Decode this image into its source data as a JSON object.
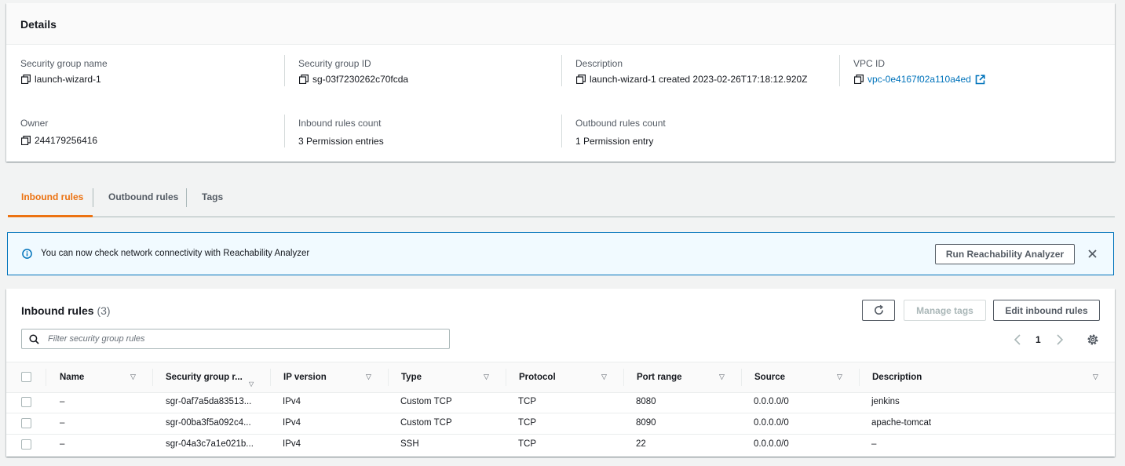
{
  "details": {
    "title": "Details",
    "fields": {
      "sg_name": {
        "label": "Security group name",
        "value": "launch-wizard-1"
      },
      "sg_id": {
        "label": "Security group ID",
        "value": "sg-03f7230262c70fcda"
      },
      "description": {
        "label": "Description",
        "value": "launch-wizard-1 created 2023-02-26T17:18:12.920Z"
      },
      "vpc_id": {
        "label": "VPC ID",
        "value": "vpc-0e4167f02a110a4ed"
      },
      "owner": {
        "label": "Owner",
        "value": "244179256416"
      },
      "inbound_count": {
        "label": "Inbound rules count",
        "value": "3 Permission entries"
      },
      "outbound_count": {
        "label": "Outbound rules count",
        "value": "1 Permission entry"
      }
    }
  },
  "tabs": [
    {
      "label": "Inbound rules",
      "active": true
    },
    {
      "label": "Outbound rules",
      "active": false
    },
    {
      "label": "Tags",
      "active": false
    }
  ],
  "flash": {
    "message": "You can now check network connectivity with Reachability Analyzer",
    "button": "Run Reachability Analyzer"
  },
  "rules_table": {
    "title": "Inbound rules",
    "count": "(3)",
    "buttons": {
      "manage_tags": "Manage tags",
      "edit": "Edit inbound rules"
    },
    "filter_placeholder": "Filter security group rules",
    "page": "1",
    "columns": [
      "Name",
      "Security group r...",
      "IP version",
      "Type",
      "Protocol",
      "Port range",
      "Source",
      "Description"
    ],
    "rows": [
      [
        "–",
        "sgr-0af7a5da83513...",
        "IPv4",
        "Custom TCP",
        "TCP",
        "8080",
        "0.0.0.0/0",
        "jenkins"
      ],
      [
        "–",
        "sgr-00ba3f5a092c4...",
        "IPv4",
        "Custom TCP",
        "TCP",
        "8090",
        "0.0.0.0/0",
        "apache-tomcat"
      ],
      [
        "–",
        "sgr-04a3c7a1e021b...",
        "IPv4",
        "SSH",
        "TCP",
        "22",
        "0.0.0.0/0",
        "–"
      ]
    ]
  },
  "colors": {
    "accent": "#ec7211",
    "link": "#0073bb",
    "info_bg": "#f1faff"
  }
}
